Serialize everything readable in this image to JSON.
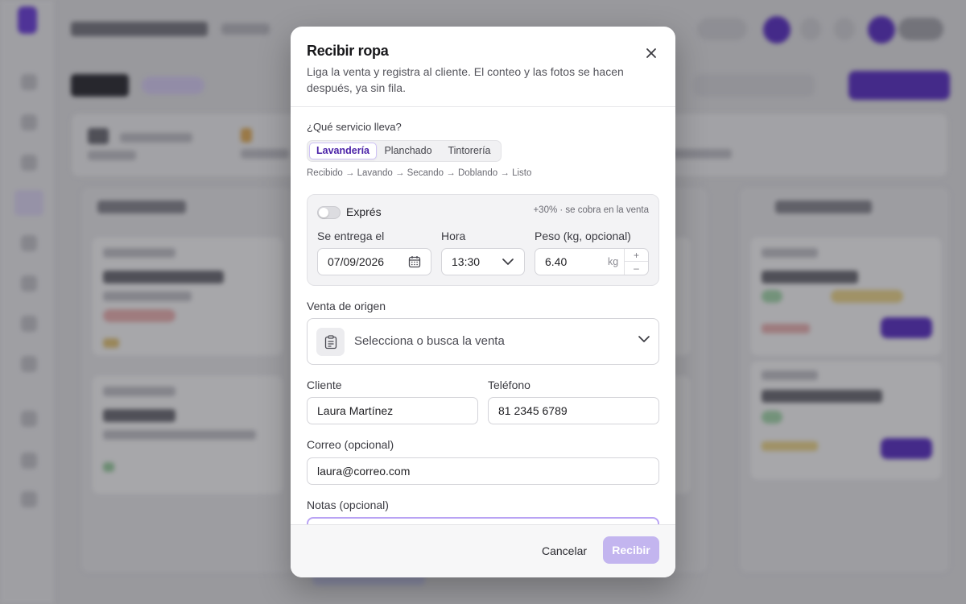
{
  "modal": {
    "title": "Recibir ropa",
    "description": "Liga la venta y registra al cliente. El conteo y las fotos se hacen después, ya sin fila.",
    "close_icon": "close-icon"
  },
  "service": {
    "question": "¿Qué servicio lleva?",
    "options": [
      "Lavandería",
      "Planchado",
      "Tintorería"
    ],
    "selected": "Lavandería",
    "flow": "Recibido → Lavando → Secando → Doblando → Listo"
  },
  "express": {
    "label": "Exprés",
    "enabled": false,
    "surcharge": "+30% · se cobra en la venta"
  },
  "delivery": {
    "date_label": "Se entrega el",
    "date_value": "07/09/2026",
    "time_label": "Hora",
    "time_value": "13:30",
    "weight_label": "Peso (kg, opcional)",
    "weight_value": "6.40",
    "weight_unit": "kg",
    "step_up": "+",
    "step_down": "–"
  },
  "sale": {
    "label": "Venta de origen",
    "placeholder": "Selecciona o busca la venta",
    "icon": "clipboard-icon"
  },
  "customer": {
    "name_label": "Cliente",
    "name_value": "Laura Martínez",
    "phone_label": "Teléfono",
    "phone_value": "81 2345 6789",
    "email_label": "Correo (opcional)",
    "email_value": "laura@correo.com",
    "notes_label": "Notas (opcional)",
    "notes_value": ""
  },
  "footer": {
    "cancel_label": "Cancelar",
    "submit_label": "Recibir"
  },
  "colors": {
    "accent": "#5b2fc9",
    "accent_soft": "#c3b5ef",
    "focus_border": "#b9a3f4"
  }
}
